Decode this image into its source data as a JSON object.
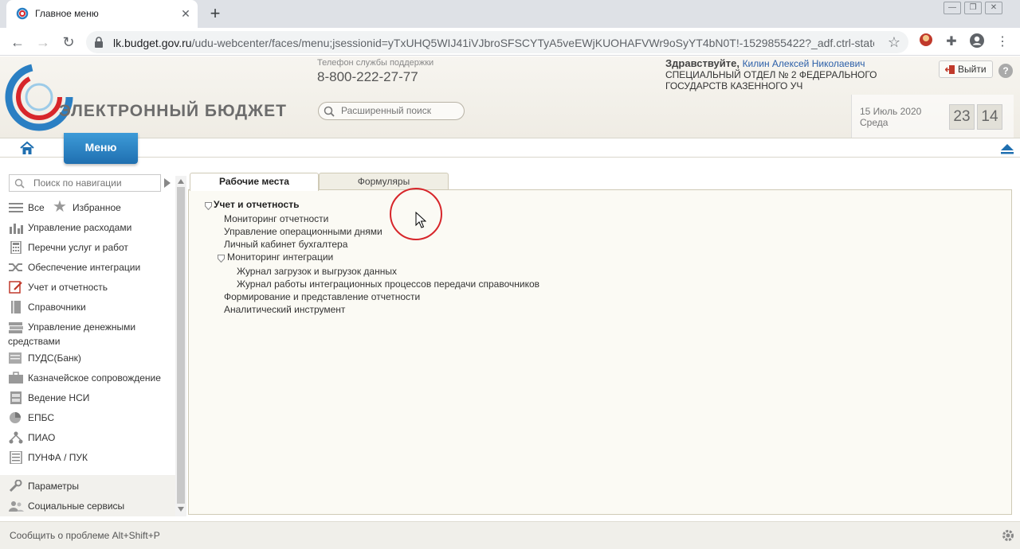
{
  "browser": {
    "tab_title": "Главное меню",
    "url_main": "lk.budget.gov.ru",
    "url_rest": "/udu-webcenter/faces/menu;jsessionid=yTxUHQ5WIJ41iVJbroSFSCYTyA5veEWjKUOHAFVWr9oSyYT4bN0T!-1529855422?_adf.ctrl-state=..."
  },
  "header": {
    "logo_text": "ЭЛЕКТРОННЫЙ БЮДЖЕТ",
    "support_label": "Телефон службы поддержки",
    "support_phone": "8-800-222-27-77",
    "search_placeholder": "Расширенный поиск",
    "greeting": "Здравствуйте,",
    "user_name": "Килин Алексей Николаевич",
    "organization": "СПЕЦИАЛЬНЫЙ ОТДЕЛ № 2 ФЕДЕРАЛЬНОГО ГОСУДАРСТВ КАЗЕННОГО УЧ",
    "logout_label": "Выйти",
    "help_label": "?",
    "date": "15 Июль 2020",
    "weekday": "Среда",
    "hours": "23",
    "minutes": "14"
  },
  "navbar": {
    "menu_label": "Меню"
  },
  "sidebar": {
    "search_placeholder": "Поиск по навигации",
    "all_label": "Все",
    "favorites_label": "Избранное",
    "items": [
      {
        "label": "Управление расходами"
      },
      {
        "label": "Перечни услуг и работ"
      },
      {
        "label": "Обеспечение интеграции"
      },
      {
        "label": "Учет и отчетность"
      },
      {
        "label": "Справочники"
      },
      {
        "label": "Управление денежными",
        "label2": "средствами"
      },
      {
        "label": "ПУДС(Банк)"
      },
      {
        "label": "Казначейское сопровождение"
      },
      {
        "label": "Ведение НСИ"
      },
      {
        "label": "ЕПБС"
      },
      {
        "label": "ПИАО"
      },
      {
        "label": "ПУНФА / ПУК"
      }
    ],
    "bottom": [
      {
        "label": "Параметры"
      },
      {
        "label": "Социальные сервисы"
      }
    ]
  },
  "main": {
    "tabs": [
      {
        "label": "Рабочие места",
        "active": true
      },
      {
        "label": "Формуляры",
        "active": false
      }
    ],
    "tree": {
      "root": "Учет и отчетность",
      "items": [
        "Мониторинг отчетности",
        "Управление операционными днями",
        "Личный кабинет бухгалтера"
      ],
      "group": "Мониторинг интеграции",
      "group_items": [
        "Журнал загрузок и выгрузок данных",
        "Журнал работы интеграционных процессов передачи справочников"
      ],
      "tail_items": [
        "Формирование и представление отчетности",
        "Аналитический инструмент"
      ]
    }
  },
  "footer": {
    "report_text": "Сообщить о проблеме Alt+Shift+P"
  },
  "colors": {
    "menu_button": "#2a7fc3",
    "accent_blue": "#2a5ea8",
    "click_marker": "#d7262b"
  }
}
